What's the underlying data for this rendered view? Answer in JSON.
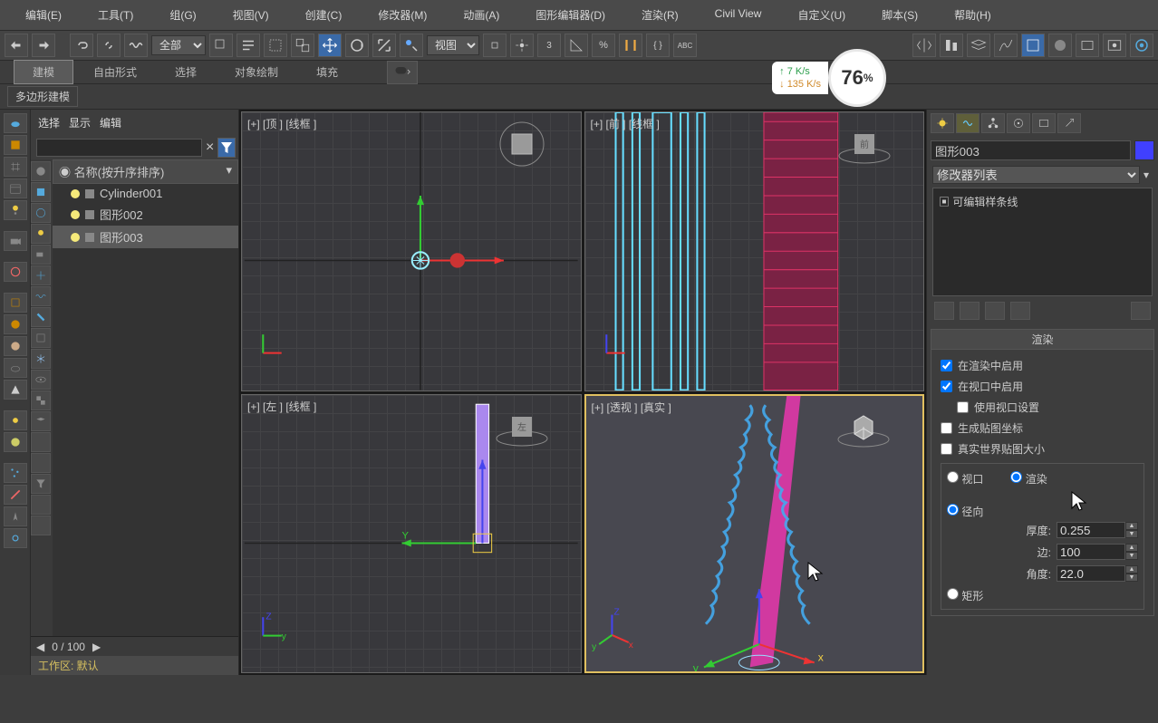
{
  "menu": [
    "编辑(E)",
    "工具(T)",
    "组(G)",
    "视图(V)",
    "创建(C)",
    "修改器(M)",
    "动画(A)",
    "图形编辑器(D)",
    "渲染(R)",
    "Civil View",
    "自定义(U)",
    "脚本(S)",
    "帮助(H)"
  ],
  "toolbar": {
    "sel_filter": "全部",
    "coord_sys": "视图",
    "spin_val": "3"
  },
  "ribbon": {
    "tabs": [
      "建模",
      "自由形式",
      "选择",
      "对象绘制",
      "填充"
    ],
    "panel_label": "多边形建模"
  },
  "scene": {
    "head": [
      "选择",
      "显示",
      "编辑"
    ],
    "search_close": "×",
    "name_header": "名称(按升序排序)",
    "items": [
      {
        "label": "Cylinder001",
        "sel": false
      },
      {
        "label": "图形002",
        "sel": false
      },
      {
        "label": "图形003",
        "sel": true
      }
    ]
  },
  "viewports": {
    "vp1": "[+] [顶 ] [线框 ]",
    "vp2": "[+]  [前 ] [线框 ]",
    "vp3": "[+] [左 ] [线框 ]",
    "vp4": "[+]  [透视 ] [真实 ]",
    "cube_front": "前",
    "cube_left": "左"
  },
  "network": {
    "up": "7  K/s",
    "down": "135 K/s",
    "pct": "76",
    "pct_suffix": "%"
  },
  "cmd": {
    "obj_name": "图形003",
    "mod_list_label": "修改器列表",
    "stack_item": "可编辑样条线",
    "rollout_title": "渲染",
    "cb_render_enable": "在渲染中启用",
    "cb_viewport_enable": "在视口中启用",
    "cb_use_viewport": "使用视口设置",
    "cb_gen_map": "生成贴图坐标",
    "cb_real_world": "真实世界贴图大小",
    "r_viewport": "视口",
    "r_render": "渲染",
    "r_radial": "径向",
    "r_rect": "矩形",
    "p_thickness_label": "厚度:",
    "p_thickness_val": "0.255",
    "p_sides_label": "边:",
    "p_sides_val": "100",
    "p_angle_label": "角度:",
    "p_angle_val": "22.0"
  },
  "timeline": {
    "pos": "0 / 100"
  },
  "statusbar": {
    "workarea": "工作区: 默认"
  }
}
